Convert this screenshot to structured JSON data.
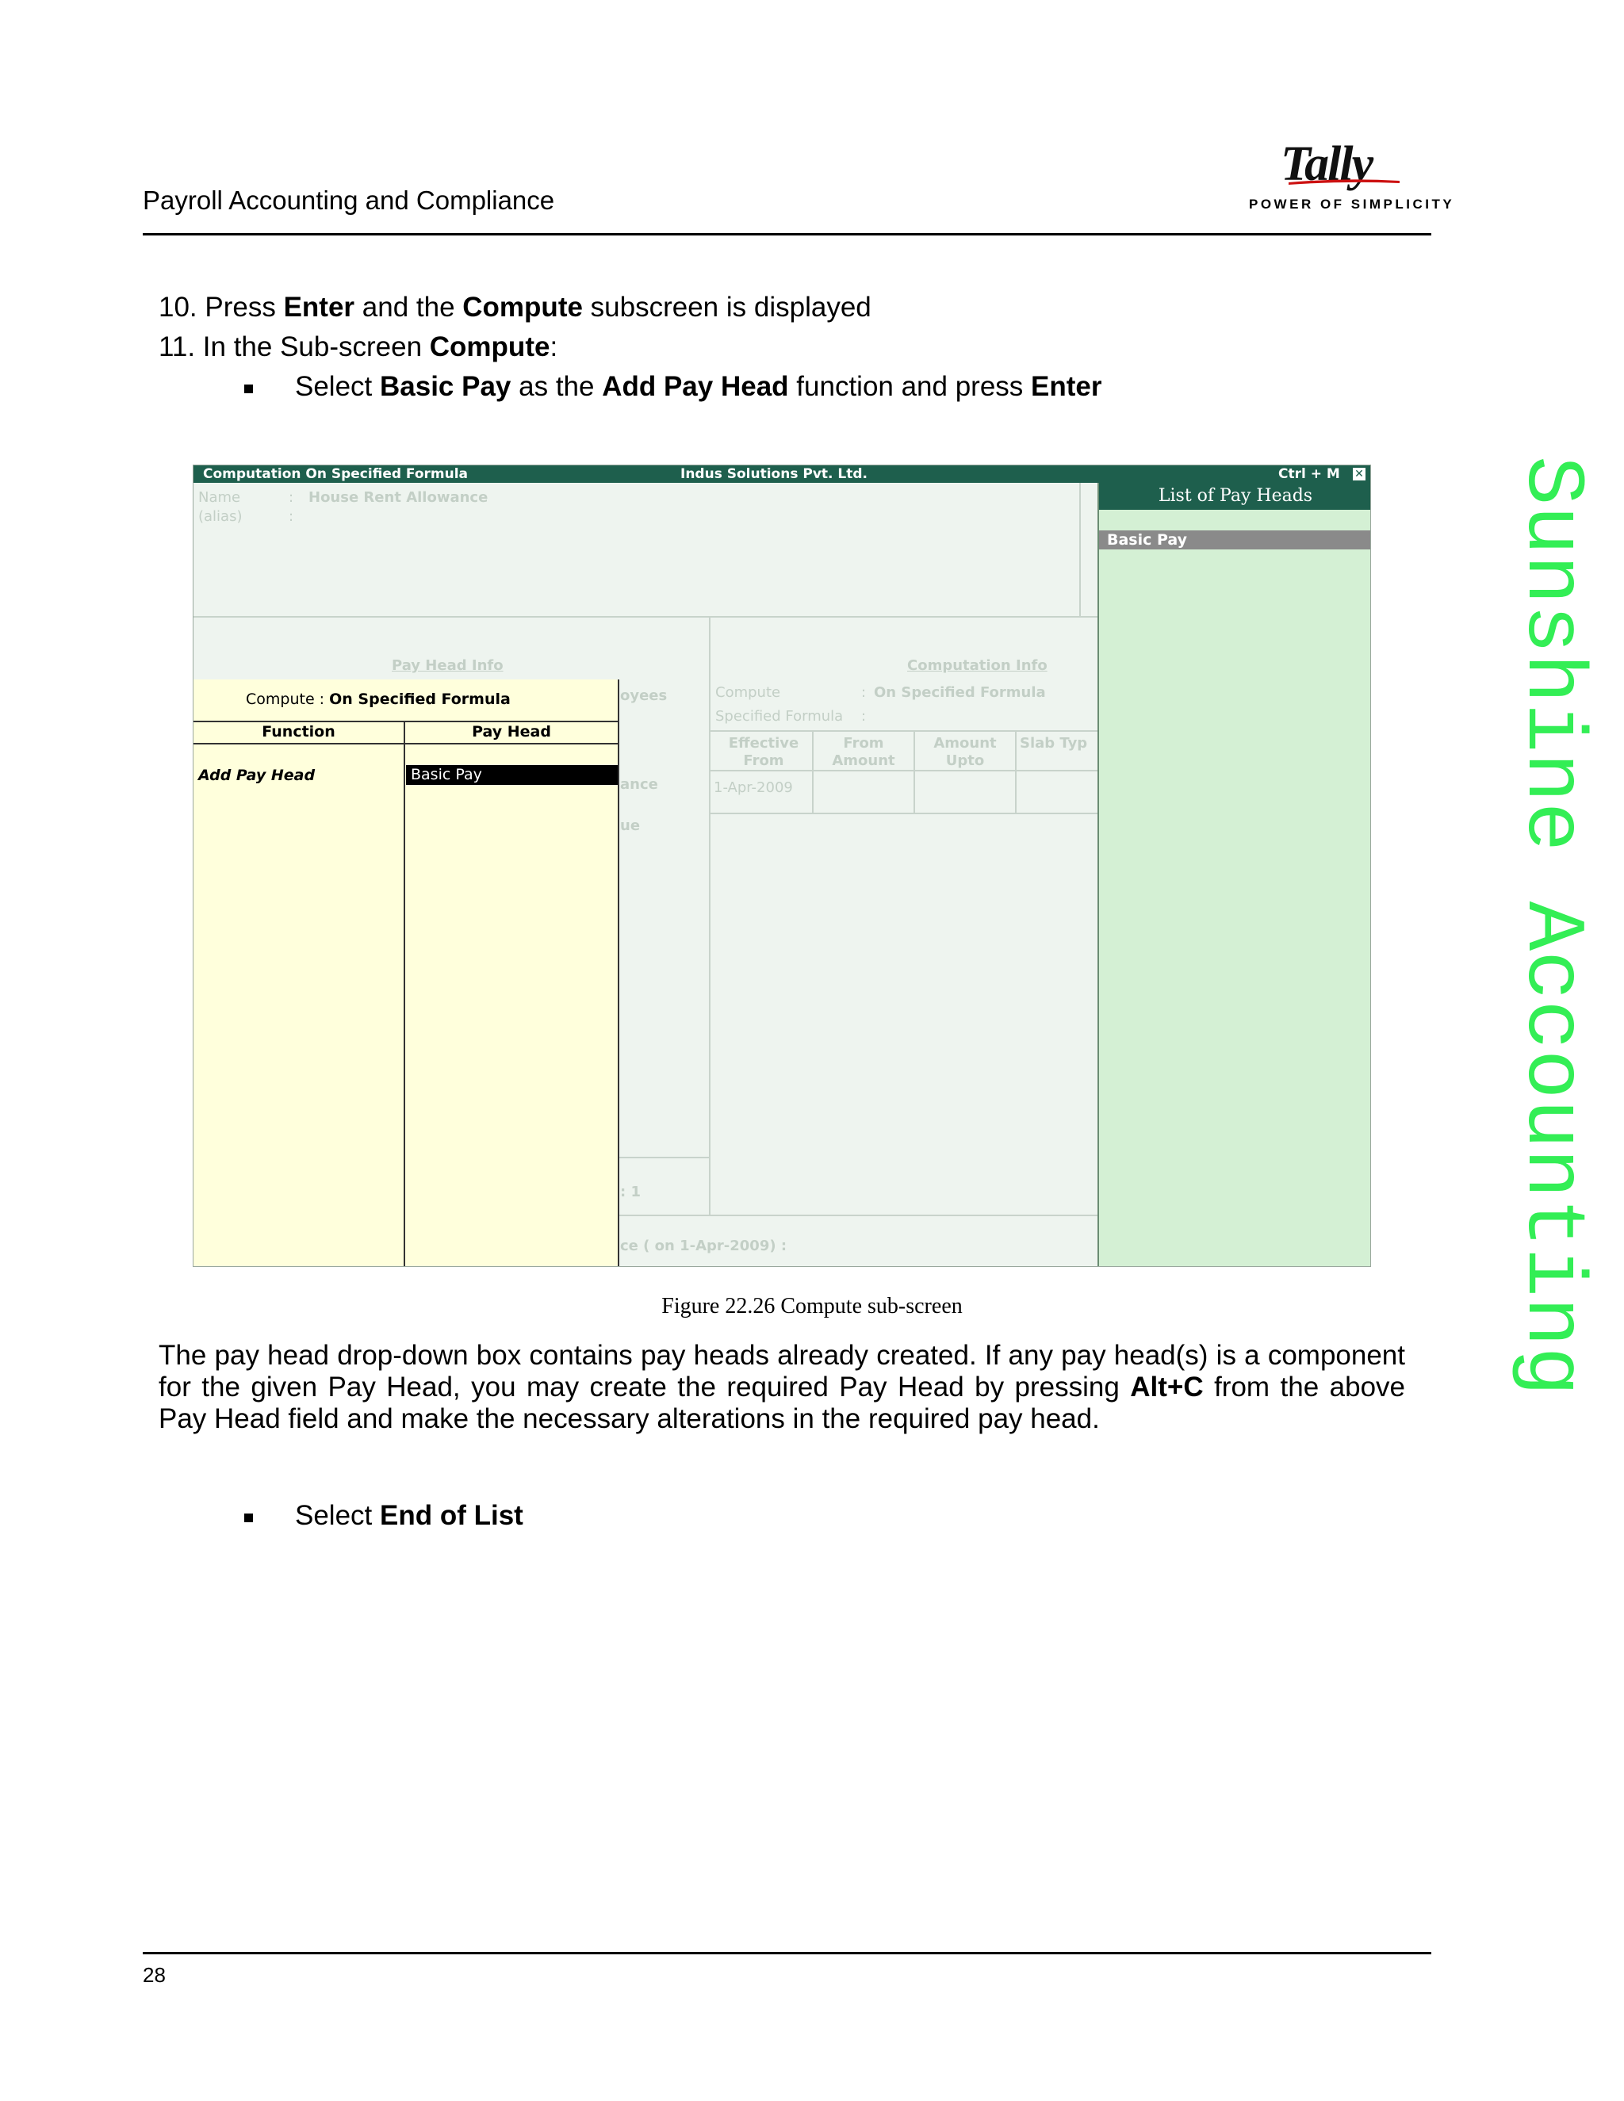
{
  "header": {
    "title": "Payroll Accounting and Compliance",
    "logo_text": "Tally",
    "logo_tagline": "POWER OF SIMPLICITY"
  },
  "steps": {
    "s10": {
      "num": "10. Press ",
      "b1": "Enter",
      "t1": " and the ",
      "b2": "Compute",
      "t2": " subscreen is displayed"
    },
    "s11": {
      "num": "11. In the Sub-screen ",
      "b1": "Compute",
      "t1": ":"
    },
    "bullet1": {
      "t0": "Select ",
      "b1": "Basic Pay",
      "t1": " as the ",
      "b2": "Add Pay Head",
      "t2": " function and press ",
      "b3": "Enter"
    },
    "bullet2": {
      "t0": "Select ",
      "b1": "End of List"
    }
  },
  "screen": {
    "title_left": "Computation On Specified Formula",
    "title_mid": "Indus Solutions Pvt. Ltd.",
    "title_right": "Ctrl + M",
    "close_glyph": "✕",
    "bg": {
      "name_label": "Name",
      "name_value": "House Rent Allowance",
      "alias_label": "(alias)",
      "pay_head_info": "Pay Head Info",
      "employees_frag": "oyees",
      "ance_frag": "ance",
      "ue_frag": "ue",
      "one_frag": ":  1",
      "ce_frag": "ce    ( on 1-Apr-2009)  :",
      "computation_info": "Computation Info",
      "compute_label": "Compute",
      "compute_value": "On Specified Formula",
      "specified_formula_label": "Specified Formula",
      "col_effective_from": "Effective From",
      "col_from_amount": "From Amount",
      "col_amount_upto": "Amount Upto",
      "col_slab_type": "Slab Typ",
      "row_date": "1-Apr-2009"
    },
    "compute_panel": {
      "label": "Compute : ",
      "value": "On Specified Formula",
      "col_function": "Function",
      "col_pay_head": "Pay Head",
      "row_function": "Add Pay Head",
      "row_pay_head": "Basic Pay"
    },
    "list_panel": {
      "title": "List of Pay Heads",
      "items": [
        "Basic Pay"
      ]
    }
  },
  "caption": "Figure 22.26  Compute sub-screen",
  "paragraph": "The pay head drop-down box contains pay heads already created. If any pay head(s) is a component for the given Pay Head, you may create the required Pay Head by pressing ",
  "paragraph_bold": "Alt+C",
  "paragraph_end": " from the above Pay Head field and make the necessary alterations in the required pay head.",
  "watermark": "Sunshine Accounting",
  "footer": {
    "page_number": "28"
  }
}
